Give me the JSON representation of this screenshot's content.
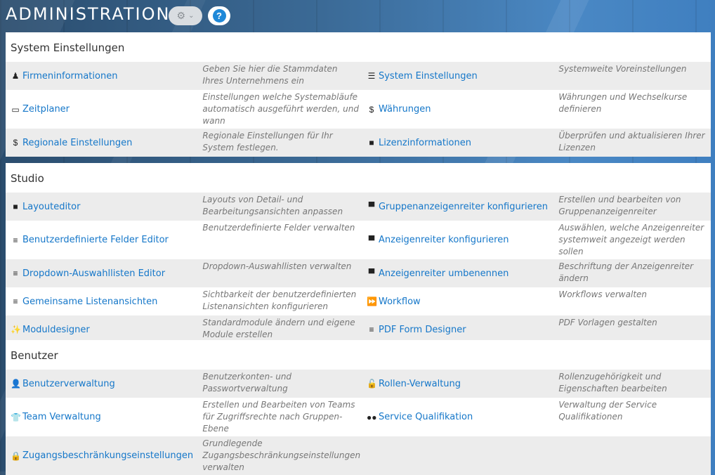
{
  "header": {
    "title": "ADMINISTRATION",
    "gear_icon": "⚙",
    "chevron_icon": "»",
    "help_icon": "?"
  },
  "sections": [
    {
      "title": "System Einstellungen",
      "rows": [
        [
          {
            "icon": "♟",
            "icon_name": "company-icon",
            "label": "Firmeninformationen",
            "desc": "Geben Sie hier die Stammdaten Ihres Unternehmens ein"
          },
          {
            "icon": "☰",
            "icon_name": "sliders-icon",
            "label": "System Einstellungen",
            "desc": "Systemweite Voreinstellungen"
          }
        ],
        [
          {
            "icon": "▭",
            "icon_name": "calendar-icon",
            "label": "Zeitplaner",
            "desc": "Einstellungen welche Systemabläufe automatisch ausgeführt werden, und wann"
          },
          {
            "icon": "$",
            "icon_name": "currency-icon",
            "label": "Währungen",
            "desc": "Währungen und Wechselkurse definieren"
          }
        ],
        [
          {
            "icon": "$",
            "icon_name": "regional-icon",
            "label": "Regionale Einstellungen",
            "desc": "Regionale Einstellungen für Ihr System festlegen."
          },
          {
            "icon": "■",
            "icon_name": "license-icon",
            "label": "Lizenzinformationen",
            "desc": "Überprüfen und aktualisieren Ihrer Lizenzen"
          }
        ]
      ]
    },
    {
      "title": "Studio",
      "rows": [
        [
          {
            "icon": "■",
            "icon_name": "layout-icon",
            "label": "Layouteditor",
            "desc": "Layouts von Detail- und Bearbeitungsansichten anpassen"
          },
          {
            "icon": "▀",
            "icon_name": "tab-icon",
            "label": "Gruppenanzeigenreiter konfigurieren",
            "desc": "Erstellen und bearbeiten von Gruppenanzeigenreiter"
          }
        ],
        [
          {
            "icon": "≡",
            "icon_name": "list-icon",
            "label": "Benutzerdefinierte Felder Editor",
            "desc": "Benutzerdefinierte Felder verwalten"
          },
          {
            "icon": "▀",
            "icon_name": "tab-icon",
            "label": "Anzeigenreiter konfigurieren",
            "desc": "Auswählen, welche Anzeigenreiter systemweit angezeigt werden sollen"
          }
        ],
        [
          {
            "icon": "≡",
            "icon_name": "list-icon",
            "label": "Dropdown-Auswahllisten Editor",
            "desc": "Dropdown-Auswahllisten verwalten"
          },
          {
            "icon": "▀",
            "icon_name": "tab-icon",
            "label": "Anzeigenreiter umbenennen",
            "desc": "Beschriftung der Anzeigenreiter ändern"
          }
        ],
        [
          {
            "icon": "≡",
            "icon_name": "list-icon",
            "label": "Gemeinsame Listenansichten",
            "desc": "Sichtbarkeit der benutzerdefinierten Listenansichten konfigurieren"
          },
          {
            "icon": "⏩",
            "icon_name": "workflow-icon",
            "label": "Workflow",
            "desc": "Workflows verwalten"
          }
        ],
        [
          {
            "icon": "✨",
            "icon_name": "magic-wand-icon",
            "label": "Moduldesigner",
            "desc": "Standardmodule ändern und eigene Module erstellen"
          },
          {
            "icon": "≡",
            "icon_name": "list-icon",
            "label": "PDF Form Designer",
            "desc": "PDF Vorlagen gestalten"
          }
        ]
      ]
    },
    {
      "title": "Benutzer",
      "rows": [
        [
          {
            "icon": "👤",
            "icon_name": "user-icon",
            "label": "Benutzerverwaltung",
            "desc": "Benutzerkonten- und Passwortverwaltung"
          },
          {
            "icon": "🔓",
            "icon_name": "unlock-icon",
            "label": "Rollen-Verwaltung",
            "desc": "Rollenzugehörigkeit und Eigenschaften bearbeiten"
          }
        ],
        [
          {
            "icon": "👕",
            "icon_name": "team-icon",
            "label": "Team Verwaltung",
            "desc": "Erstellen und Bearbeiten von Teams für Zugriffsrechte nach Gruppen-Ebene"
          },
          {
            "icon": "●●",
            "icon_name": "service-icon",
            "label": "Service Qualifikation",
            "desc": "Verwaltung der Service Qualifikationen"
          }
        ],
        [
          {
            "icon": "🔒",
            "icon_name": "lock-icon",
            "label": "Zugangsbeschränkungseinstellungen",
            "desc": "Grundlegende Zugangsbeschränkungseinstellungen verwalten"
          },
          null
        ]
      ]
    }
  ]
}
